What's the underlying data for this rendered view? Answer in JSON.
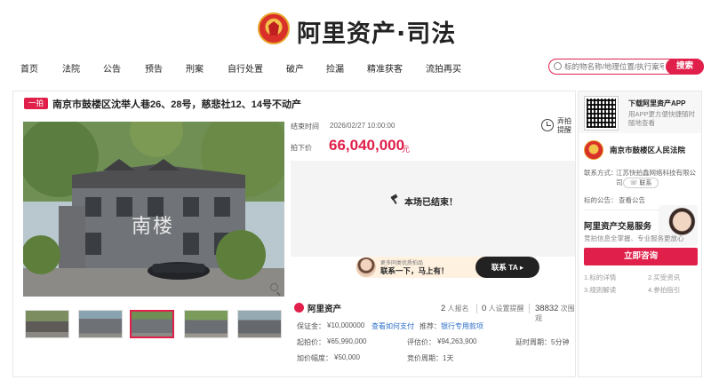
{
  "header": {
    "logo_text": "阿里资产·司法"
  },
  "nav": {
    "items": [
      "首页",
      "法院",
      "公告",
      "预告",
      "刑案",
      "自行处置",
      "破产",
      "捡漏",
      "精准获客",
      "流拍再买"
    ]
  },
  "search": {
    "placeholder": "标的物名称/地理位置/执行案号",
    "button": "搜索"
  },
  "listing": {
    "tag": "一拍",
    "title": "南京市鼓楼区沈举人巷26、28号，慈悲社12、14号不动产",
    "photo_caption": "南楼"
  },
  "auction": {
    "end_time_label": "结束时间",
    "end_time": "2026/02/27 10:00:00",
    "final_price_label": "拍下价",
    "final_price": "66,040,000",
    "price_unit": "元",
    "remind_label": "弄拍提醒",
    "status_text": "本场已结束！",
    "contact": {
      "small": "更多同类优质拍品",
      "main": "联系一下，马上有！",
      "button": "联系 TA ▸"
    }
  },
  "stats": {
    "platform": "阿里资产",
    "signups": "2",
    "signups_label": "人报名",
    "reminders": "0",
    "reminders_label": "人设置提醒",
    "views": "38832",
    "views_label": "次围观",
    "deposit_label": "保证金：",
    "deposit": "¥10,000000",
    "payment_link": "查看如何支付",
    "recommend_label": "推荐：",
    "recommend_link": "银行专用款项",
    "start_price_label": "起拍价：",
    "start_price": "¥65,990,000",
    "appraisal_label": "评估价：",
    "appraisal": "¥94,263,900",
    "extend_label": "延时周期：",
    "extend": "5分钟",
    "increment_label": "加价幅度：",
    "increment": "¥50,000",
    "bid_cycle_label": "竞价周期：",
    "bid_cycle": "1天"
  },
  "sidebar": {
    "app_title": "下载阿里资产APP",
    "app_sub": "用APP更方便快捷随时随地查看",
    "court_name": "南京市鼓楼区人民法院",
    "contact_label": "联系方式：",
    "contact_value": "江苏快拍鑫网络科技有限公司",
    "phone_button": "☏ 联系",
    "notice_label": "标的公告：",
    "notice_link": "查看公告",
    "service_title": "阿里资产交易服务",
    "service_sub": "竞拍信息全掌握、专业服务更放心",
    "consult_button": "立即咨询",
    "steps": [
      "1.标的详情",
      "2.买受资讯",
      "3.规则解读",
      "4.参拍指引"
    ]
  },
  "colors": {
    "brand": "#e0204a",
    "link": "#2c6fc9"
  }
}
